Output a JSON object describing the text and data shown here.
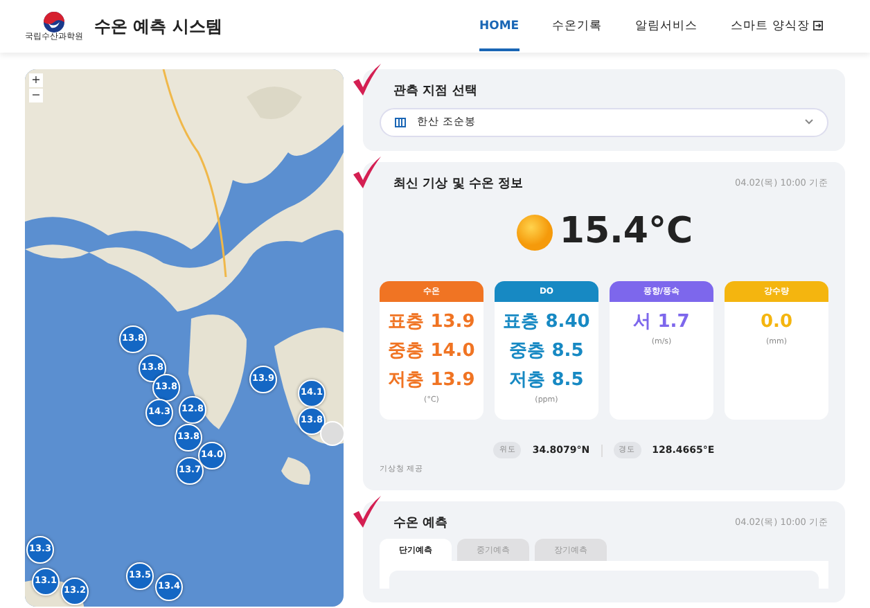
{
  "header": {
    "logo_caption": "국립수산과학원",
    "title": "수온 예측 시스템",
    "nav": [
      {
        "label": "HOME",
        "selected": true,
        "external": false
      },
      {
        "label": "수온기록",
        "selected": false,
        "external": false
      },
      {
        "label": "알림서비스",
        "selected": false,
        "external": false
      },
      {
        "label": "스마트 양식장",
        "selected": false,
        "external": true
      }
    ]
  },
  "map": {
    "zoom_in": "+",
    "zoom_out": "−",
    "markers": [
      "13.8",
      "13.8",
      "13.8",
      "14.3",
      "12.8",
      "13.8",
      "14.0",
      "13.7",
      "13.9",
      "14.1",
      "13.8",
      "13.3",
      "13.1",
      "13.2",
      "13.5",
      "13.4"
    ]
  },
  "station": {
    "title": "관측 지점 선택",
    "value": "한산 조순봉"
  },
  "weather": {
    "title": "최신 기상 및 수온 정보",
    "time": "04.02(목) 10:00 기준",
    "temperature": "15.4°C",
    "cards": [
      {
        "header": "수온",
        "color": "#f07423",
        "lines": [
          "표층 13.9",
          "중층 14.0",
          "저층 13.9"
        ],
        "unit": "(°C)"
      },
      {
        "header": "DO",
        "color": "#1789c3",
        "lines": [
          "표층 8.40",
          "중층 8.5",
          "저층 8.5"
        ],
        "unit": "(ppm)"
      },
      {
        "header": "풍향/풍속",
        "color": "#7d67ec",
        "lines": [
          "서 1.7"
        ],
        "unit": "(m/s)"
      },
      {
        "header": "강수량",
        "color": "#f4b50f",
        "lines": [
          "0.0"
        ],
        "unit": "(mm)"
      }
    ],
    "coords": [
      {
        "label": "위도",
        "value": "34.8079°N"
      },
      {
        "label": "경도",
        "value": "128.4665°E"
      }
    ],
    "source": "기상청 제공"
  },
  "forecast": {
    "title": "수온 예측",
    "time": "04.02(목) 10:00 기준",
    "tabs": [
      {
        "label": "단기예측",
        "selected": true
      },
      {
        "label": "중기예측",
        "selected": false
      },
      {
        "label": "장기예측",
        "selected": false
      }
    ]
  }
}
